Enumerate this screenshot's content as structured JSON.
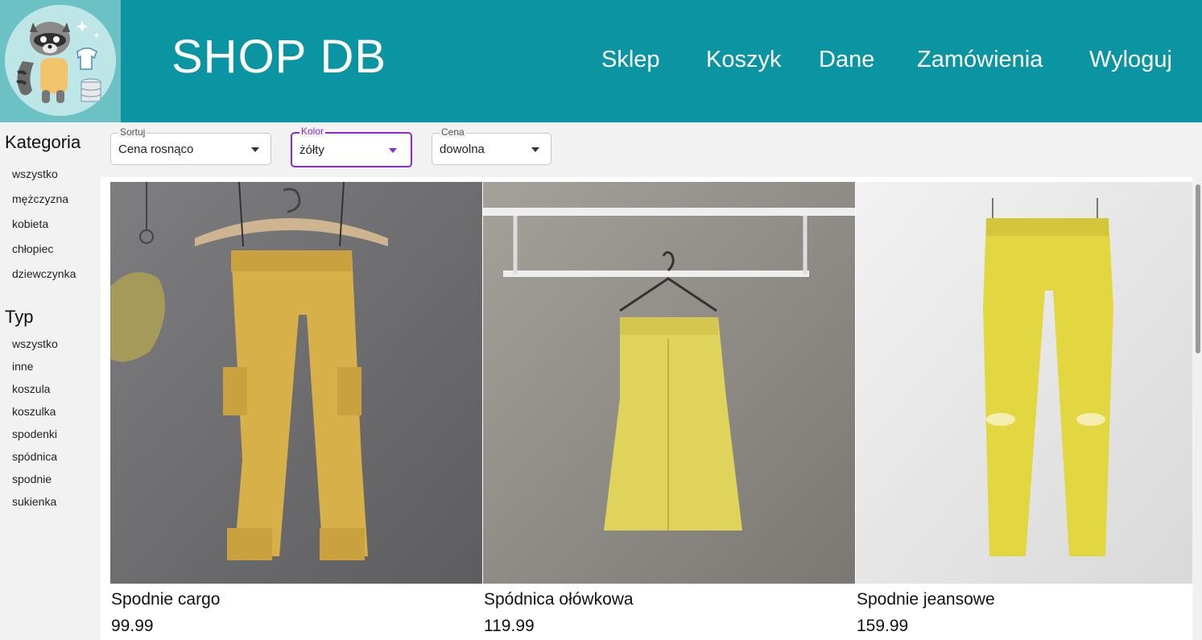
{
  "header": {
    "brand": "SHOP DB",
    "nav": [
      "Sklep",
      "Koszyk",
      "Dane",
      "Zamówienia",
      "Wyloguj"
    ]
  },
  "sidebar": {
    "category_title": "Kategoria",
    "categories": [
      "wszystko",
      "mężczyzna",
      "kobieta",
      "chłopiec",
      "dziewczynka"
    ],
    "type_title": "Typ",
    "types": [
      "wszystko",
      "inne",
      "koszula",
      "koszulka",
      "spodenki",
      "spódnica",
      "spodnie",
      "sukienka"
    ]
  },
  "filters": {
    "sort": {
      "label": "Sortuj",
      "value": "Cena rosnąco"
    },
    "color": {
      "label": "Kolor",
      "value": "żółty"
    },
    "price": {
      "label": "Cena",
      "value": "dowolna"
    }
  },
  "products": [
    {
      "name": "Spodnie cargo",
      "price": "99.99"
    },
    {
      "name": "Spódnica ołówkowa",
      "price": "119.99"
    },
    {
      "name": "Spodnie jeansowe",
      "price": "159.99"
    }
  ],
  "colors": {
    "header": "#0b95a3",
    "active_accent": "#8a2bd6",
    "garment": "#d9c24c"
  },
  "icons": {
    "logo": "raccoon-mascot-logo",
    "dropdown": "chevron-down-icon"
  }
}
